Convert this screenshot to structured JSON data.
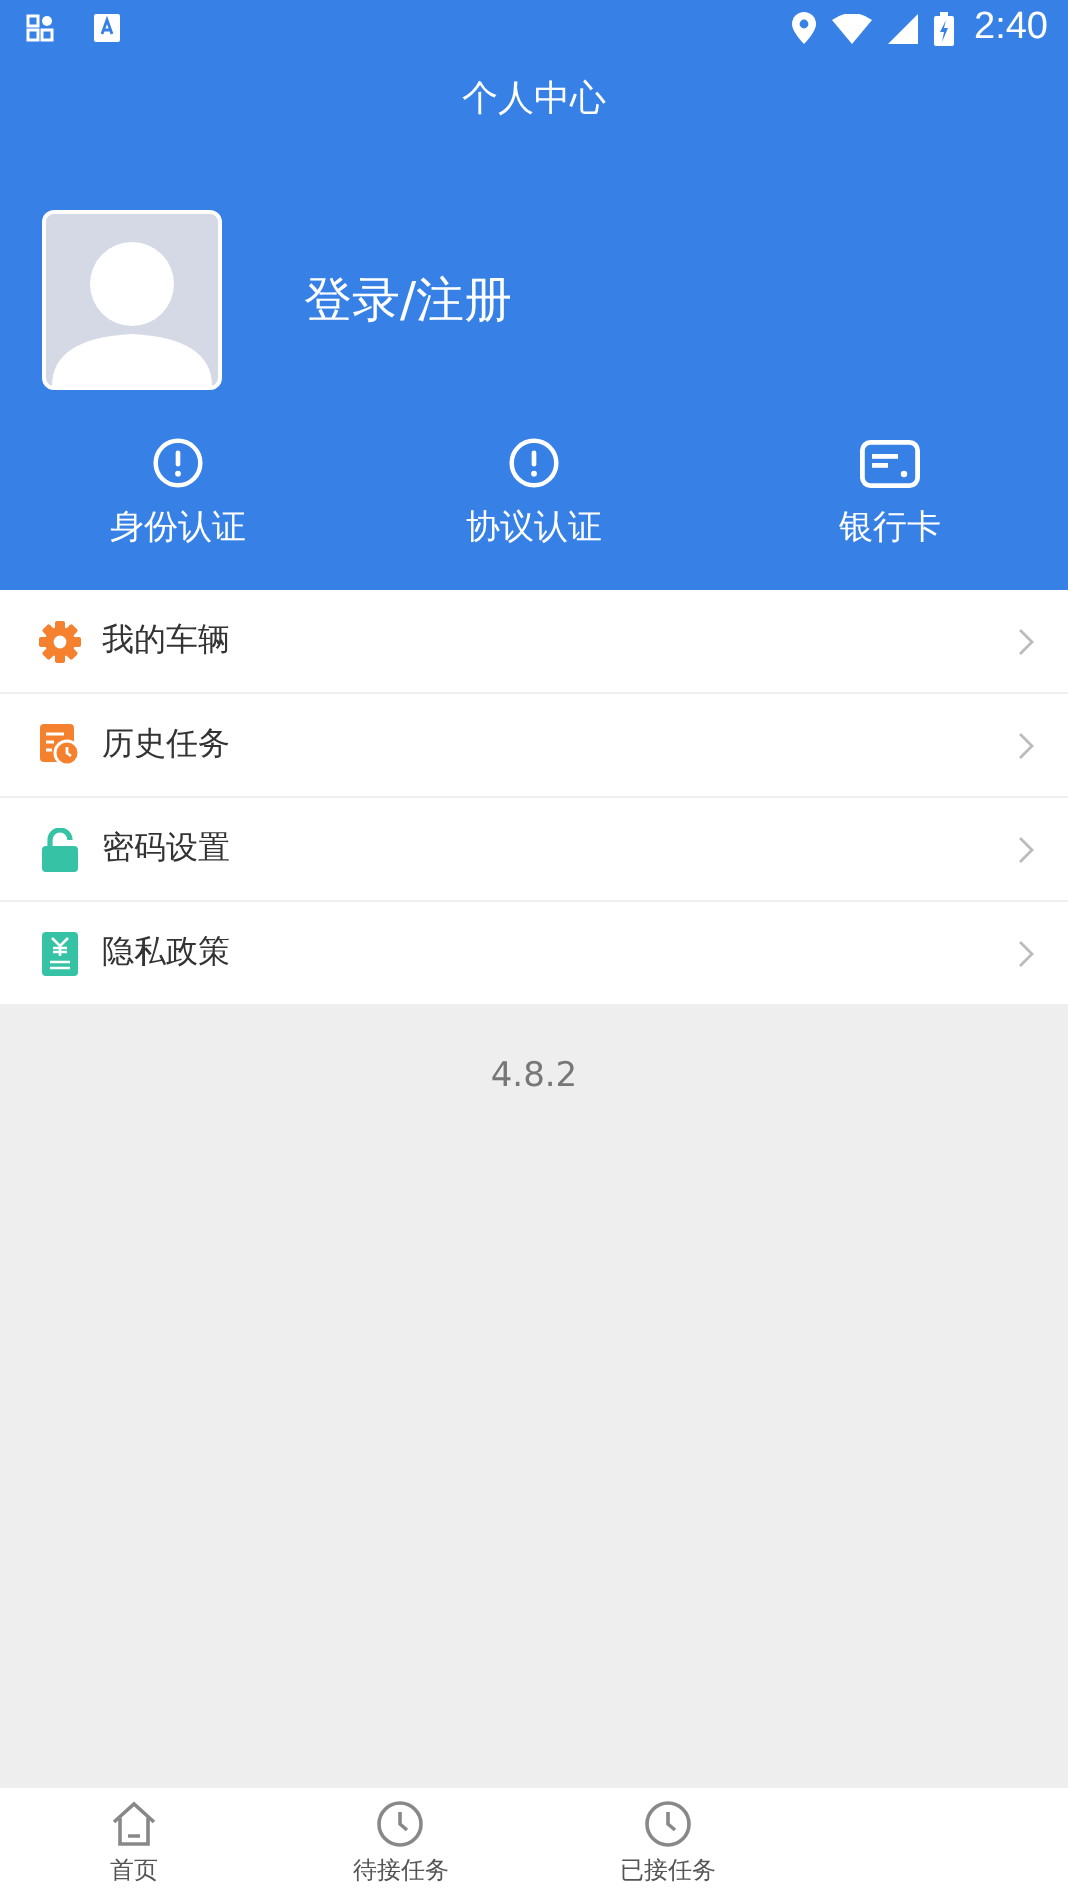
{
  "status_bar": {
    "time": "2:40"
  },
  "header": {
    "title": "个人中心",
    "login": "登录/注册"
  },
  "shortcuts": [
    {
      "label": "身份认证",
      "kind": "alert"
    },
    {
      "label": "协议认证",
      "kind": "alert"
    },
    {
      "label": "银行卡",
      "kind": "card"
    }
  ],
  "menu": [
    {
      "label": "我的车辆",
      "kind": "gear"
    },
    {
      "label": "历史任务",
      "kind": "history"
    },
    {
      "label": "密码设置",
      "kind": "lock"
    },
    {
      "label": "隐私政策",
      "kind": "doc"
    }
  ],
  "version": "4.8.2",
  "bottom_nav": [
    {
      "label": "首页",
      "kind": "home"
    },
    {
      "label": "待接任务",
      "kind": "clock"
    },
    {
      "label": "已接任务",
      "kind": "clock"
    }
  ]
}
